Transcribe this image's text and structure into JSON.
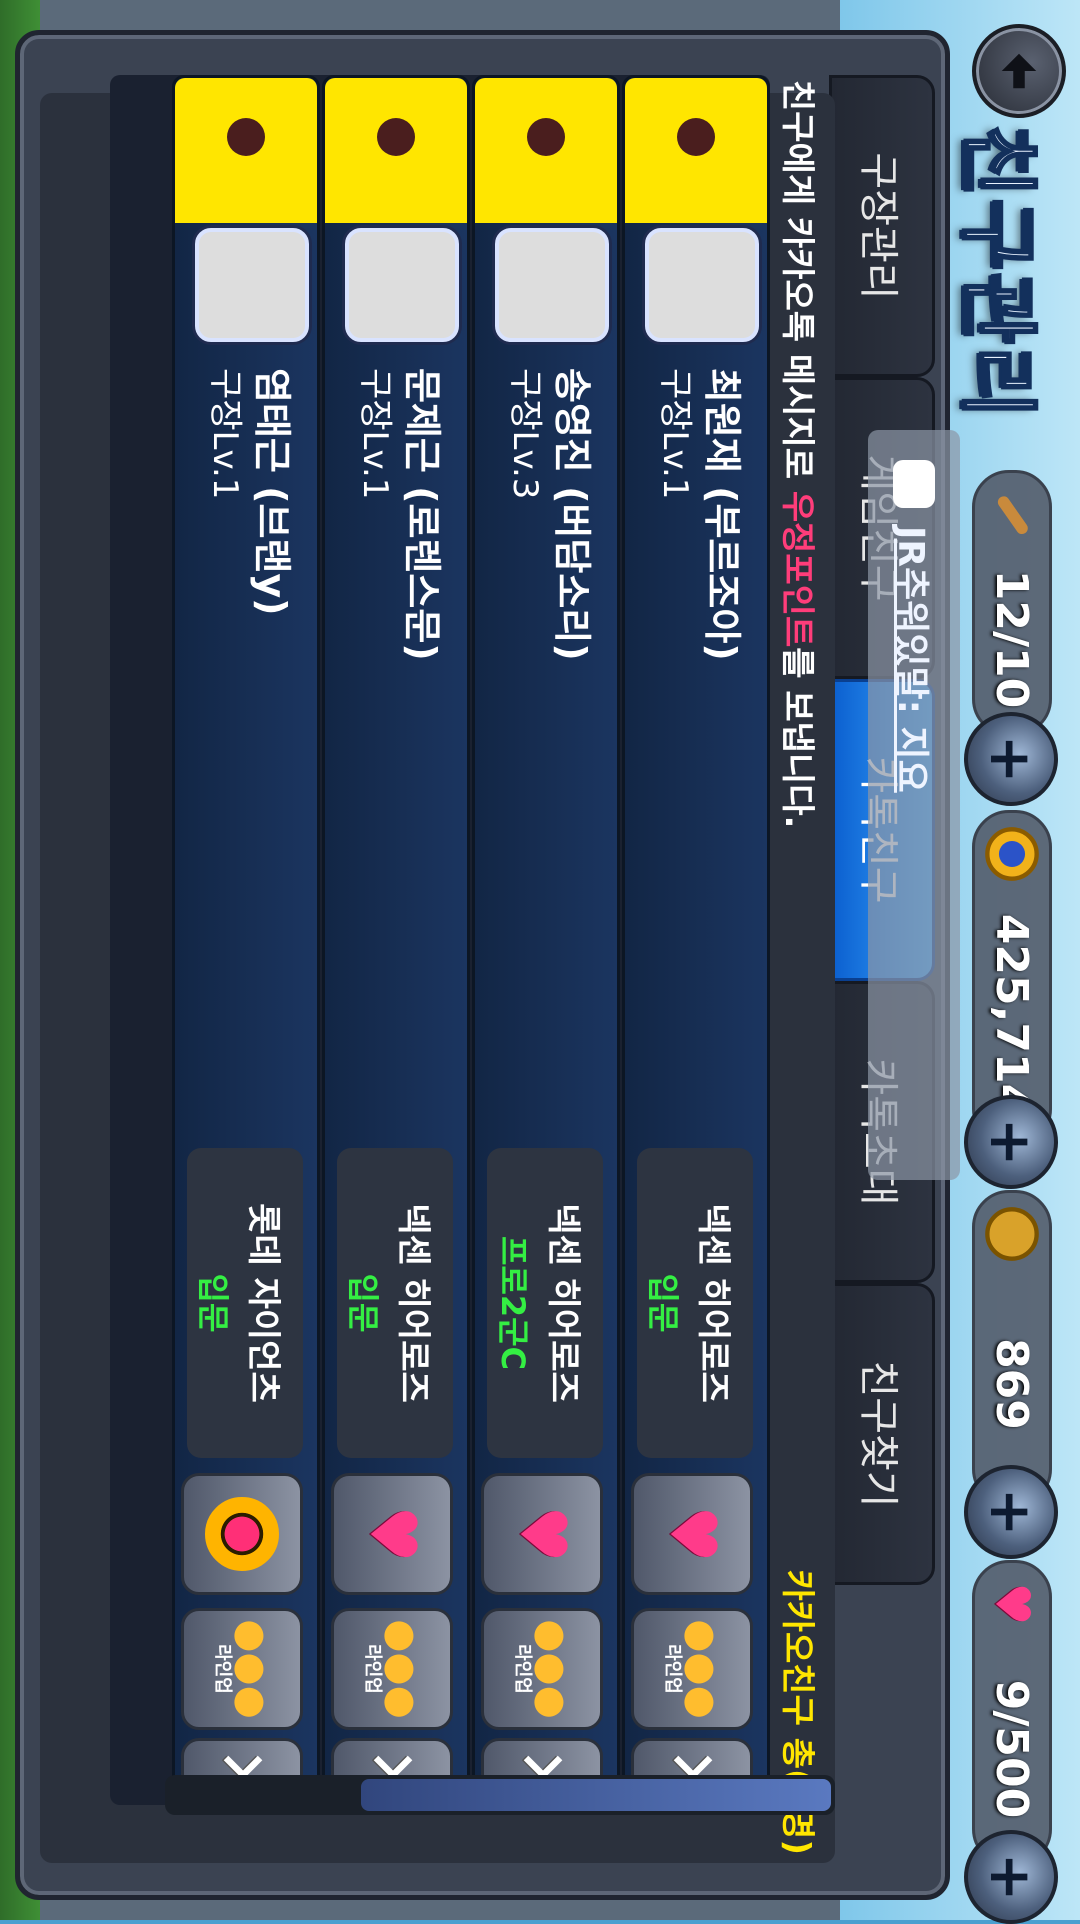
{
  "header": {
    "title": "친구관리"
  },
  "resources": [
    {
      "icon": "bat-icon",
      "value": "12/10"
    },
    {
      "icon": "gold-coin-icon",
      "value": "425,714"
    },
    {
      "icon": "baseball-icon",
      "value": "869"
    },
    {
      "icon": "heart-icon",
      "value": "9/500"
    }
  ],
  "tabs": [
    {
      "label": "구장관리",
      "active": false
    },
    {
      "label": "게임친구",
      "active": false
    },
    {
      "label": "카톡친구",
      "active": true
    },
    {
      "label": "카톡초대",
      "active": false
    },
    {
      "label": "친구찾기",
      "active": false
    }
  ],
  "notice": {
    "pre": "친구에게 카카오톡 메시지로 ",
    "highlight": "우정포인트",
    "post": "를 보냅니다."
  },
  "friends_total": "카카오친구 총(6명)",
  "toast": "JR추워있말: 지요",
  "friends": [
    {
      "name": "최원재 (부르조아)",
      "level": "구장Lv.1",
      "team": "넥센 히어로즈",
      "rank": "입문",
      "gift": "heart",
      "line_label": "라인업"
    },
    {
      "name": "송영진 (버담소리)",
      "level": "구장Lv.3",
      "team": "넥센 히어로즈",
      "rank": "프로2군C",
      "gift": "heart",
      "line_label": "라인업"
    },
    {
      "name": "문제근 (로렌스문)",
      "level": "구장Lv.1",
      "team": "넥센 히어로즈",
      "rank": "입문",
      "gift": "heart",
      "line_label": "라인업"
    },
    {
      "name": "염태근 (브랜y)",
      "level": "구장Lv.1",
      "team": "롯데 자이언츠",
      "rank": "입문",
      "gift": "ring",
      "line_label": "라인업"
    }
  ]
}
